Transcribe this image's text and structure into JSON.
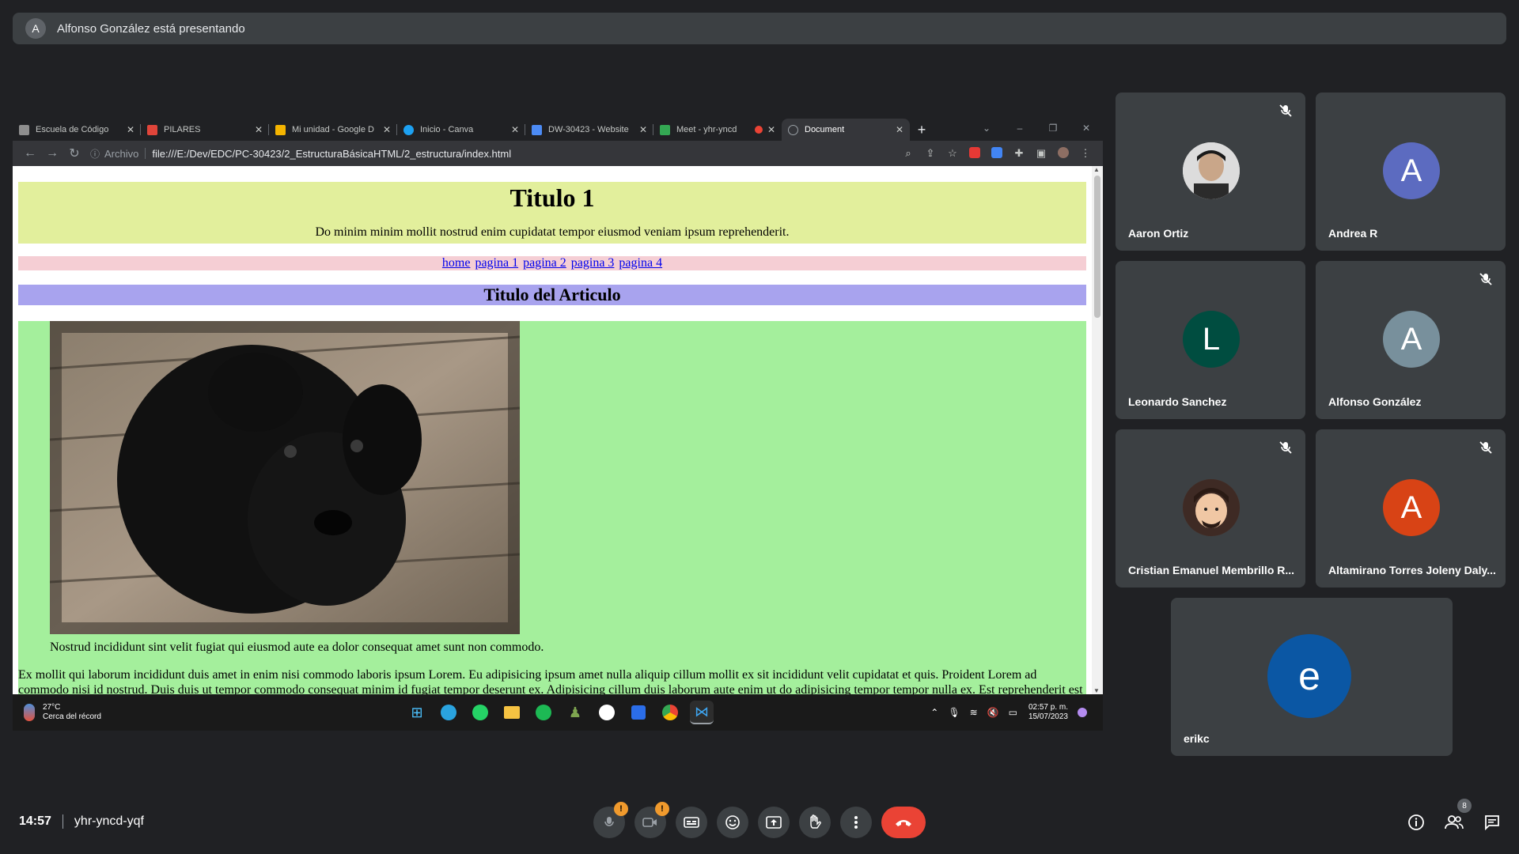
{
  "banner": {
    "avatar_letter": "A",
    "text": "Alfonso González está presentando"
  },
  "browser": {
    "tabs": [
      {
        "title": "Escuela de Código",
        "color": "#8e8e8e"
      },
      {
        "title": "PILARES",
        "color": "#e0453a"
      },
      {
        "title": "Mi unidad - Google D",
        "color": "#f4b400"
      },
      {
        "title": "Inicio - Canva",
        "color": "#1da1f2"
      },
      {
        "title": "DW-30423 - Website",
        "color": "#4c8bf5"
      },
      {
        "title": "Meet - yhr-yncd",
        "color": "#34a853"
      },
      {
        "title": "Document",
        "color": "#9aa0a6"
      }
    ],
    "new_tab": "+",
    "address": {
      "label": "Archivo",
      "url": "file:///E:/Dev/EDC/PC-30423/2_EstructuraBásicaHTML/2_estructura/index.html"
    }
  },
  "webpage": {
    "h1": "Titulo 1",
    "intro": "Do minim minim mollit nostrud enim cupidatat tempor eiusmod veniam ipsum reprehenderit.",
    "nav": [
      "home",
      "pagina 1",
      "pagina 2",
      "pagina 3",
      "pagina 4"
    ],
    "article_title": "Titulo del Articulo",
    "caption": "Nostrud incididunt sint velit fugiat qui eiusmod aute ea dolor consequat amet sunt non commodo.",
    "body": "Ex mollit qui laborum incididunt duis amet in enim nisi commodo laboris ipsum Lorem. Eu adipisicing ipsum amet nulla aliquip cillum mollit ex sit incididunt velit cupidatat et quis. Proident Lorem ad commodo nisi id nostrud. Duis duis ut tempor commodo consequat minim id fugiat tempor deserunt ex. Adipisicing cillum duis laborum aute enim ut do adipisicing tempor tempor nulla ex. Est reprehenderit est quis nostrud"
  },
  "taskbar": {
    "temp": "27°C",
    "weather_note": "Cerca del récord",
    "time": "02:57 p. m.",
    "date": "15/07/2023"
  },
  "participants": [
    {
      "name": "Aaron Ortiz",
      "letter": "",
      "color": "#d8d8d8",
      "muted": true
    },
    {
      "name": "Andrea R",
      "letter": "A",
      "color": "#5c6bc0",
      "muted": false
    },
    {
      "name": "Leonardo Sanchez",
      "letter": "L",
      "color": "#004d40",
      "muted": false
    },
    {
      "name": "Alfonso González",
      "letter": "A",
      "color": "#78909c",
      "muted": true
    },
    {
      "name": "Cristian Emanuel Membrillo R...",
      "letter": "",
      "color": "#5d4037",
      "muted": true
    },
    {
      "name": "Altamirano Torres Joleny Daly...",
      "letter": "A",
      "color": "#d84315",
      "muted": true
    },
    {
      "name": "erikc",
      "letter": "e",
      "color": "#0b57a4",
      "muted": false
    }
  ],
  "meeting": {
    "time": "14:57",
    "code": "yhr-yncd-yqf",
    "people_count": "8",
    "warn": "!"
  }
}
